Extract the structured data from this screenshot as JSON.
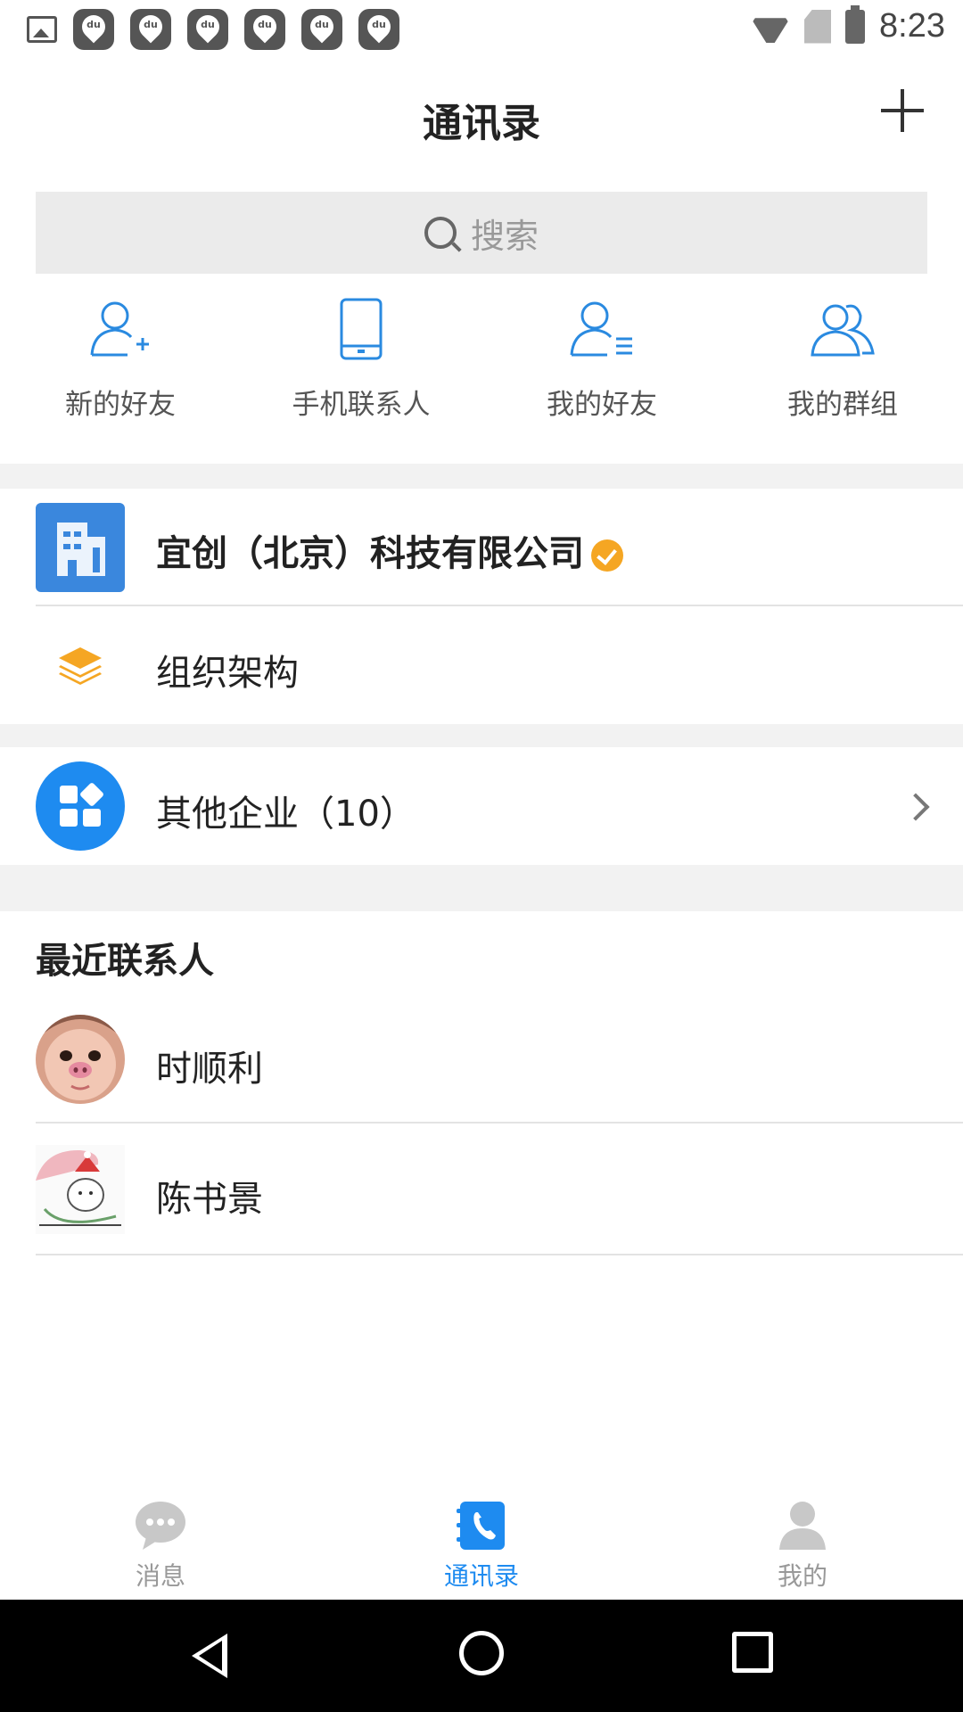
{
  "status_bar": {
    "time": "8:23",
    "notification_icons": [
      "image-icon",
      "du-icon",
      "du-icon",
      "du-icon",
      "du-icon",
      "du-icon",
      "du-icon"
    ],
    "du_text": "du"
  },
  "header": {
    "title": "通讯录",
    "add_icon": "plus-icon"
  },
  "search": {
    "placeholder": "搜索"
  },
  "quick_actions": [
    {
      "label": "新的好友",
      "icon": "add-friend-icon"
    },
    {
      "label": "手机联系人",
      "icon": "phone-contacts-icon"
    },
    {
      "label": "我的好友",
      "icon": "friend-list-icon"
    },
    {
      "label": "我的群组",
      "icon": "group-icon"
    }
  ],
  "company": {
    "name": "宜创（北京）科技有限公司",
    "verified": true
  },
  "org": {
    "label": "组织架构"
  },
  "other_enterprises": {
    "label": "其他企业（10）"
  },
  "recent": {
    "title": "最近联系人",
    "contacts": [
      {
        "name": "时顺利",
        "avatar": "avatar-photo"
      },
      {
        "name": "陈书景",
        "avatar": "avatar-photo"
      }
    ]
  },
  "bottom_nav": [
    {
      "label": "消息",
      "icon": "chat-bubble-icon",
      "active": false
    },
    {
      "label": "通讯录",
      "icon": "phone-book-icon",
      "active": true
    },
    {
      "label": "我的",
      "icon": "person-icon",
      "active": false
    }
  ],
  "colors": {
    "accent": "#1e8bf0",
    "company_icon": "#3a87dd",
    "verified_badge": "#f5a623",
    "org_icon": "#f5a623"
  }
}
